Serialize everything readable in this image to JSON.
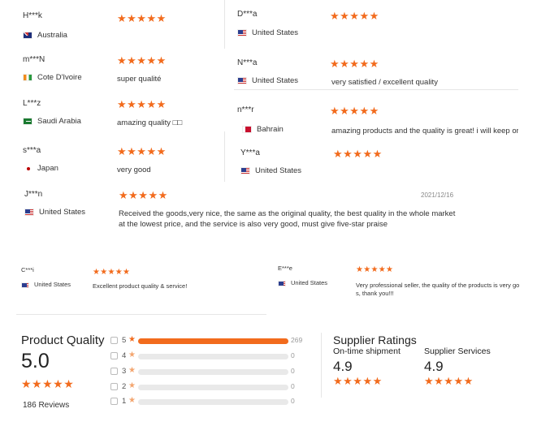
{
  "reviews_left": [
    {
      "name": "H***k",
      "country": "Australia",
      "flag": "au",
      "stars": "★★★★★",
      "comment": ""
    },
    {
      "name": "m***N",
      "country": "Cote D'Ivoire",
      "flag": "ci",
      "stars": "★★★★★",
      "comment": "super qualité"
    },
    {
      "name": "L***z",
      "country": "Saudi Arabia",
      "flag": "sa",
      "stars": "★★★★★",
      "comment": "amazing quality □□"
    },
    {
      "name": "s***a",
      "country": "Japan",
      "flag": "jp",
      "stars": "★★★★★",
      "comment": "very good"
    }
  ],
  "reviews_right": [
    {
      "name": "D***a",
      "country": "United States",
      "flag": "us",
      "stars": "★★★★★",
      "comment": ""
    },
    {
      "name": "N***a",
      "country": "United States",
      "flag": "us",
      "stars": "★★★★★",
      "comment": "very satisfied / excellent quality"
    },
    {
      "name": "n***r",
      "country": "Bahrain",
      "flag": "bh",
      "stars": "★★★★★",
      "comment": "amazing products and the quality is great! i will keep orc"
    },
    {
      "name": "Y***a",
      "country": "United States",
      "flag": "us",
      "stars": "★★★★★",
      "comment": ""
    }
  ],
  "review_wide": {
    "name": "J***n",
    "country": "United States",
    "stars": "★★★★★",
    "date": "2021/12/16",
    "line1": "Received the goods,very nice, the same as the original quality, the best quality in the whole market",
    "line2": "at the lowest price, and the service is also very good, must give five-star praise"
  },
  "review_small_left": {
    "name": "C***i",
    "country": "United States",
    "stars": "★★★★★",
    "comment": "Excellent product quality & service!"
  },
  "review_small_right": {
    "name": "E***e",
    "country": "United States",
    "stars": "★★★★★",
    "line1": "Very professional seller, the quality of the products is very go",
    "line2": "s, thank you!!!"
  },
  "summary": {
    "title": "Product Quality",
    "score": "5.0",
    "stars": "★★★★★",
    "reviews": "186 Reviews",
    "bars": [
      {
        "label": "5",
        "count": "269",
        "fraction": 1.0
      },
      {
        "label": "4",
        "count": "0",
        "fraction": 0
      },
      {
        "label": "3",
        "count": "0",
        "fraction": 0
      },
      {
        "label": "2",
        "count": "0",
        "fraction": 0
      },
      {
        "label": "1",
        "count": "0",
        "fraction": 0
      }
    ],
    "star_glyph": "★"
  },
  "supplier": {
    "title": "Supplier Ratings",
    "ontime_label": "On-time shipment",
    "ontime_score": "4.9",
    "services_label": "Supplier Services",
    "services_score": "4.9",
    "stars": "★★★★★"
  },
  "colors": {
    "accent": "#f26b1d"
  }
}
